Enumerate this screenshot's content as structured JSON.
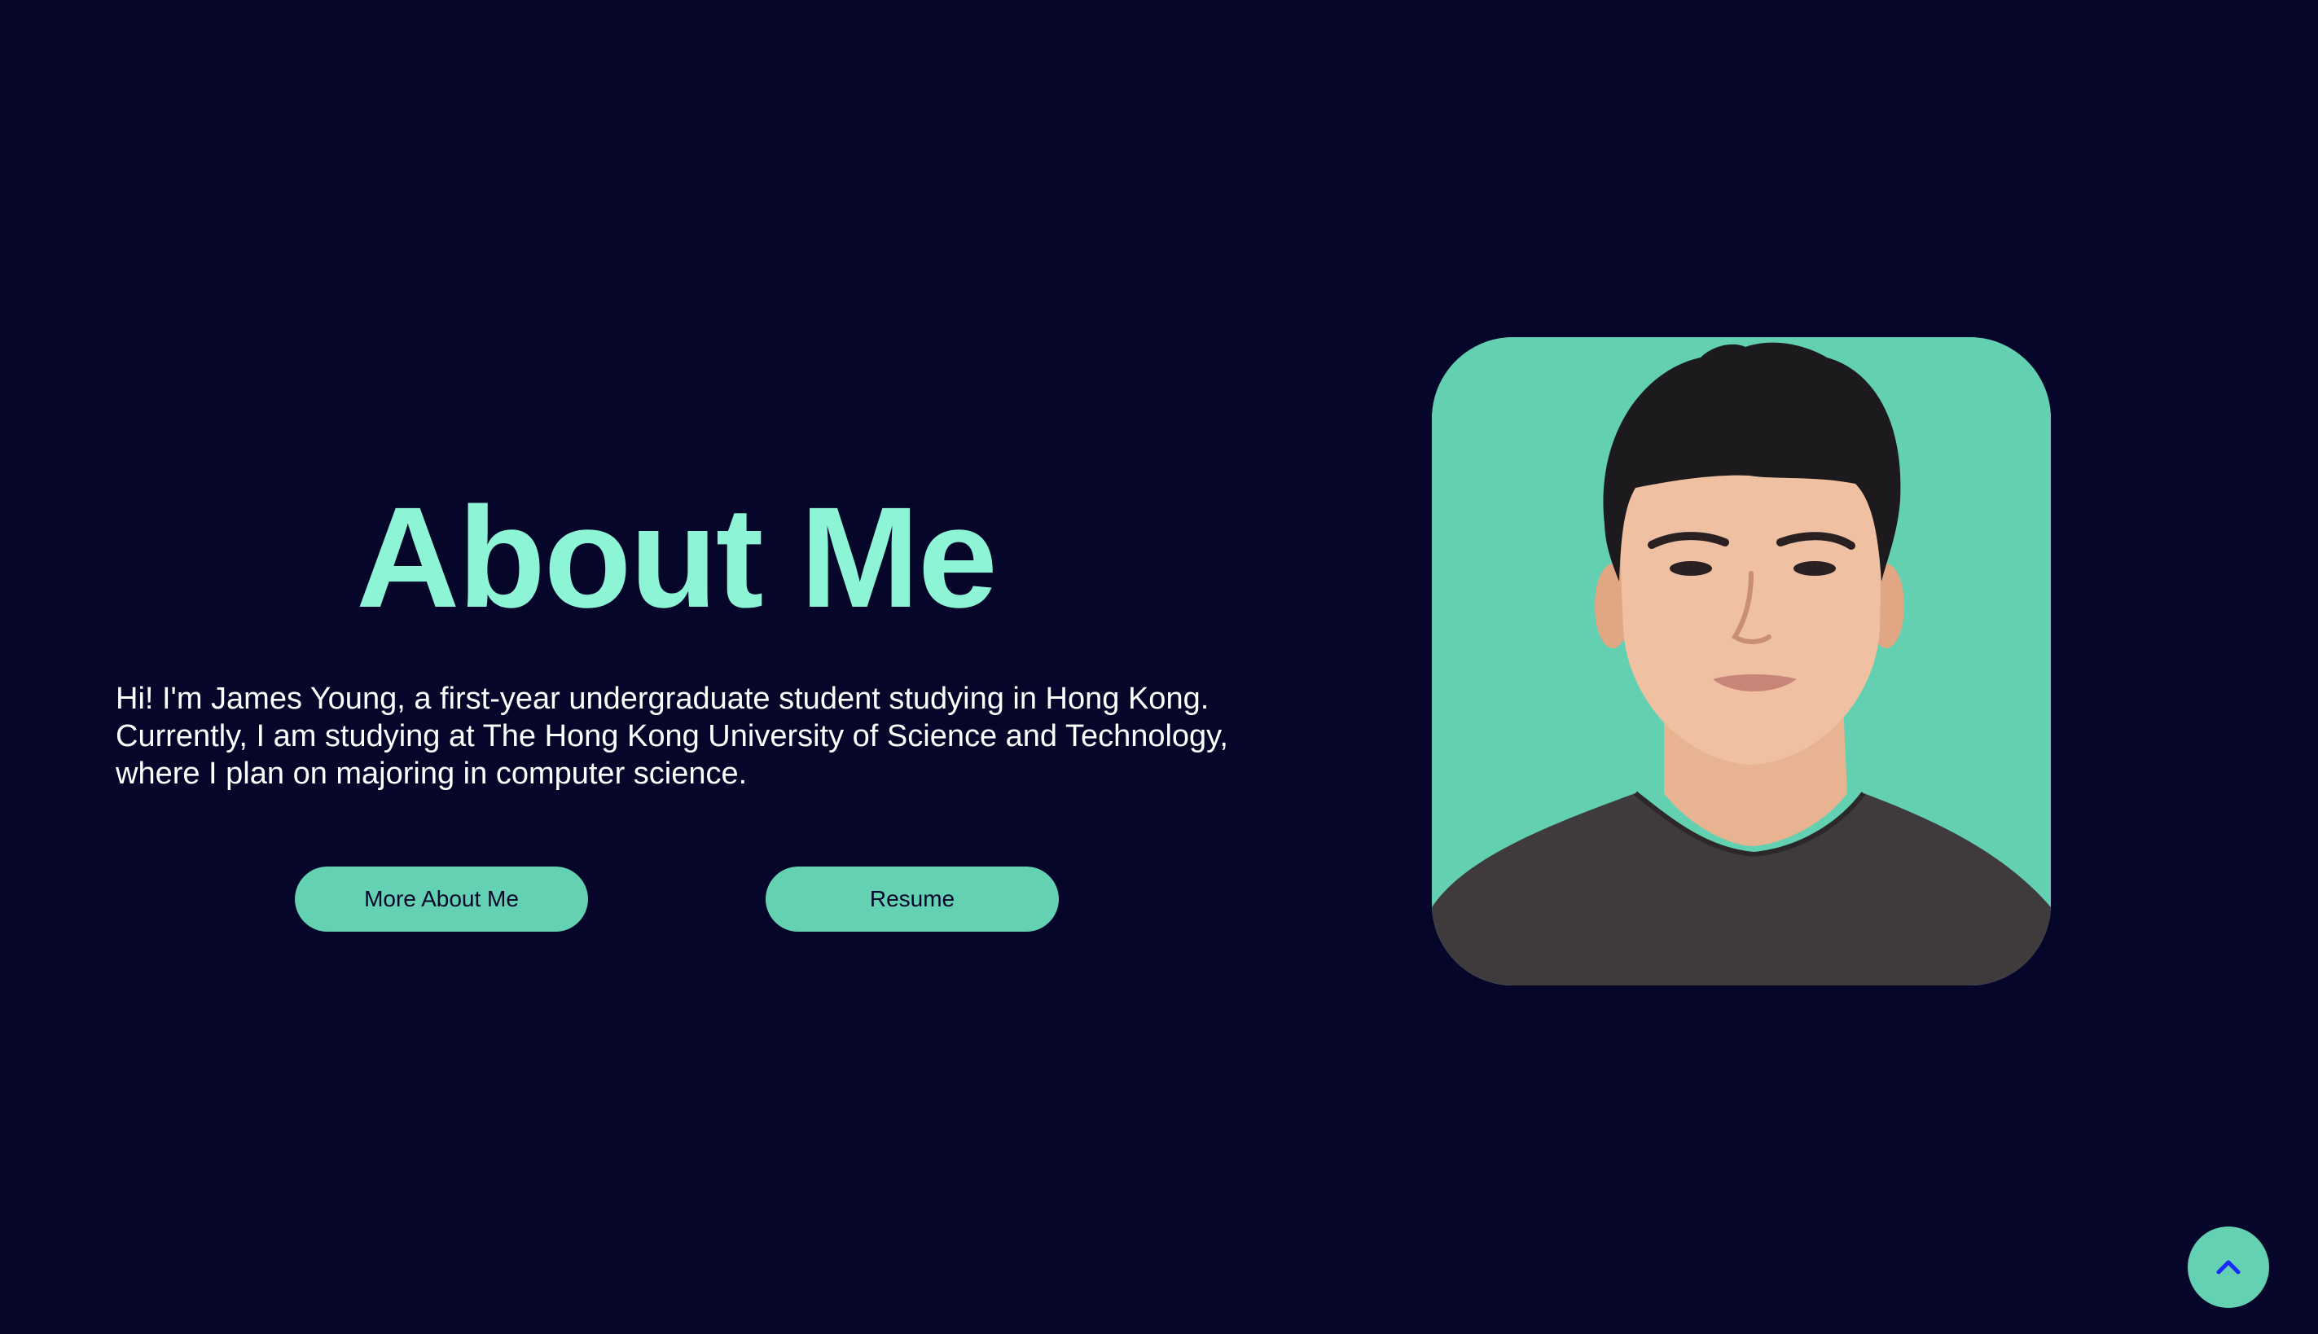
{
  "about": {
    "title": "About Me",
    "description": "Hi! I'm James Young, a first-year undergraduate student studying in Hong Kong. Currently, I am studying at The Hong Kong University of Science and Technology, where I plan on majoring in computer science.",
    "buttons": {
      "more_label": "More About Me",
      "resume_label": "Resume"
    },
    "photo_icon": "portrait-photo",
    "scroll_top_icon": "chevron-up-icon"
  },
  "colors": {
    "background": "#05062a",
    "title": "#8ef4d6",
    "accent": "#64d1b2",
    "text": "#ffffff",
    "chevron": "#1a2bff"
  }
}
